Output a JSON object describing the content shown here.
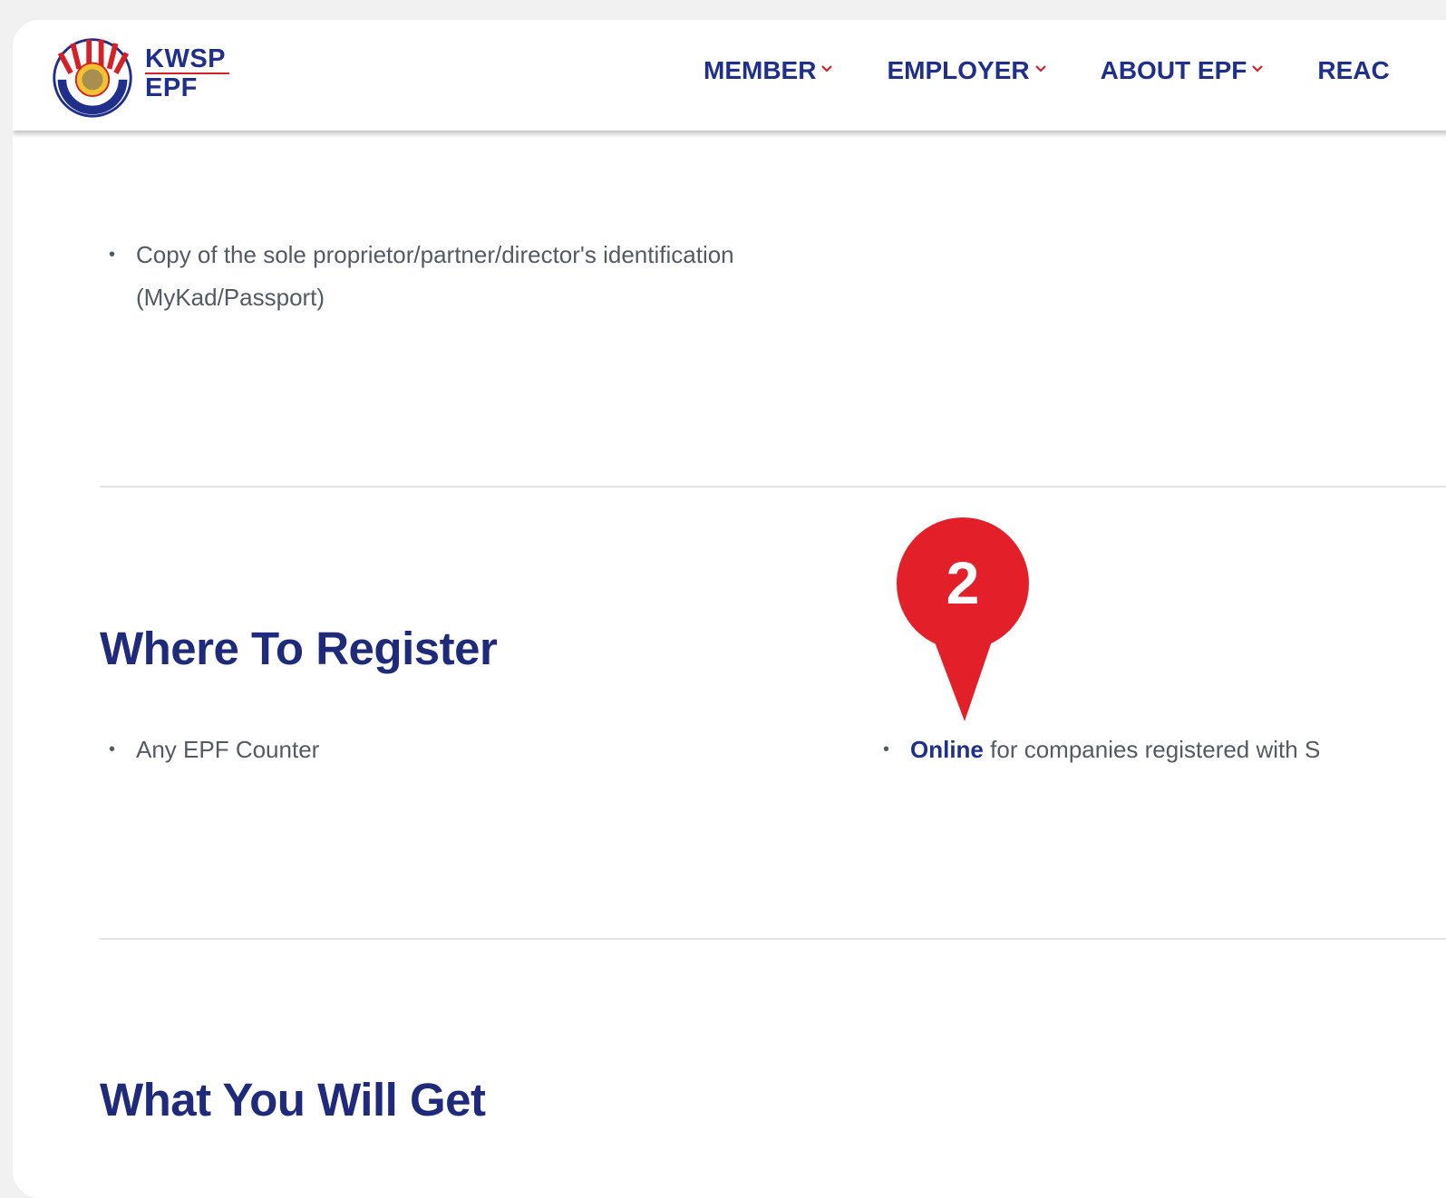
{
  "header": {
    "brand_line1": "KWSP",
    "brand_line2": "EPF",
    "nav": [
      {
        "label": "MEMBER"
      },
      {
        "label": "EMPLOYER"
      },
      {
        "label": "ABOUT EPF"
      },
      {
        "label": "REAC"
      }
    ]
  },
  "requirements": {
    "items": [
      {
        "text": "Copy of the sole proprietor/partner/director's identification (MyKad/Passport)"
      }
    ]
  },
  "where_to_register": {
    "title": "Where To Register",
    "items": [
      {
        "text": "Any EPF Counter"
      }
    ],
    "online_link": "Online",
    "online_rest": " for companies registered with S"
  },
  "what_you_will_get": {
    "title": "What You Will Get"
  },
  "annotation": {
    "number": "2",
    "color": "#e3202a"
  },
  "colors": {
    "brand_navy": "#1f2f8a",
    "accent_red": "#d62027",
    "body_text": "#545a63"
  }
}
